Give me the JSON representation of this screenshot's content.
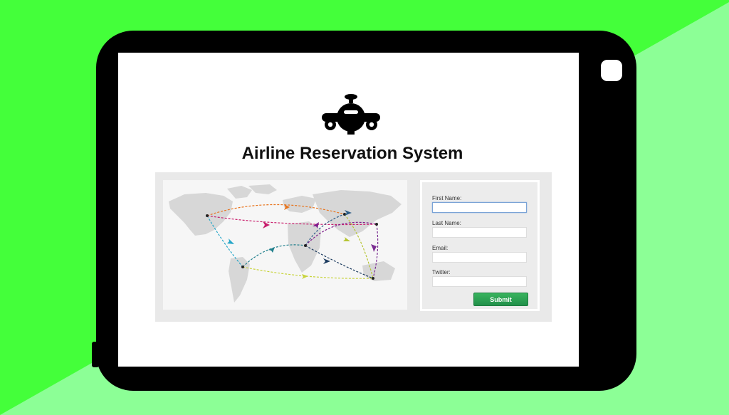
{
  "app": {
    "title": "Airline Reservation System"
  },
  "form": {
    "first_name_label": "First Name:",
    "first_name_value": "",
    "last_name_label": "Last Name:",
    "last_name_value": "",
    "email_label": "Email:",
    "email_value": "",
    "twitter_label": "Twitter:",
    "twitter_value": "",
    "submit_label": "Submit"
  },
  "icons": {
    "logo": "airplane-front-icon",
    "map": "world-map-flight-routes",
    "home": "home-button",
    "side": "side-button"
  },
  "colors": {
    "background_green": "#44ff3a",
    "background_light_green": "#8cff96",
    "device": "#000000",
    "panel": "#e9e9e9",
    "submit": "#2aa556",
    "field_focus": "#7aa3d6"
  }
}
